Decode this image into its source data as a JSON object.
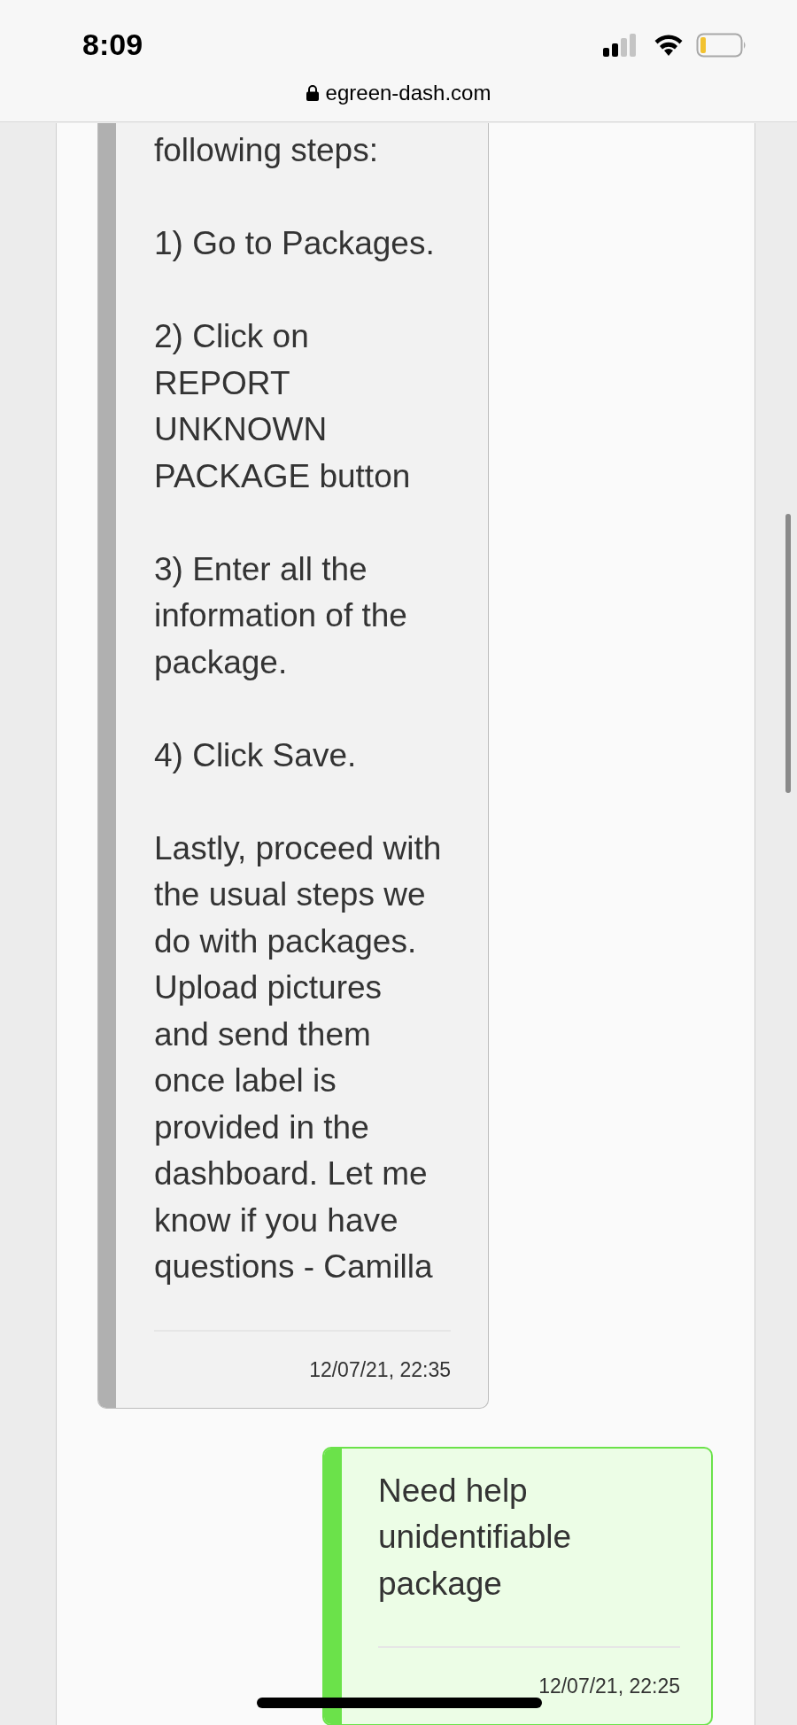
{
  "status_bar": {
    "time": "8:09"
  },
  "address_bar": {
    "url": "egreen-dash.com"
  },
  "messages": [
    {
      "kind": "received",
      "paragraphs": [
        [
          "following steps:"
        ],
        [
          "1) Go to Packages."
        ],
        [
          "2) Click on",
          "REPORT",
          "UNKNOWN",
          "PACKAGE button"
        ],
        [
          "3) Enter all the",
          "information of the",
          "package."
        ],
        [
          "4) Click Save."
        ],
        [
          "Lastly, proceed with",
          "the usual steps we",
          "do with packages.",
          "Upload pictures",
          "and send them",
          "once label is",
          "provided in the",
          "dashboard. Let me",
          "know if you have",
          "questions - Camilla"
        ]
      ],
      "timestamp": "12/07/21, 22:35"
    },
    {
      "kind": "sent",
      "paragraphs": [
        [
          "Need help",
          "unidentifiable",
          "package"
        ]
      ],
      "timestamp": "12/07/21, 22:25"
    }
  ]
}
